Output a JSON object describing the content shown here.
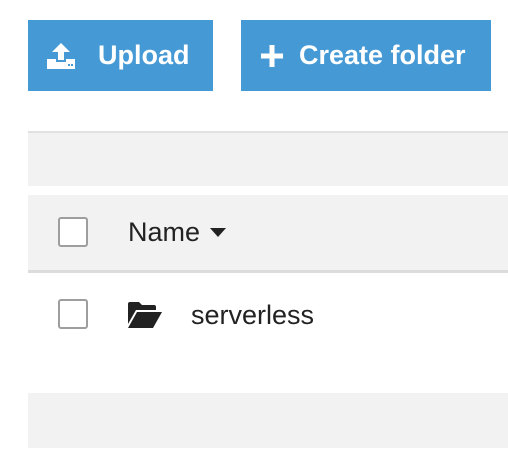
{
  "toolbar": {
    "upload_label": "Upload",
    "upload_icon": "upload-icon",
    "create_folder_label": "Create folder",
    "create_folder_icon": "plus-icon",
    "button_color": "#459ad6"
  },
  "table": {
    "columns": [
      {
        "label": "Name",
        "sort": "descending",
        "sort_icon": "caret-down-icon"
      }
    ],
    "rows": [
      {
        "type": "folder",
        "icon": "folder-open-icon",
        "name": "serverless",
        "selected": false
      }
    ],
    "select_all": false
  }
}
